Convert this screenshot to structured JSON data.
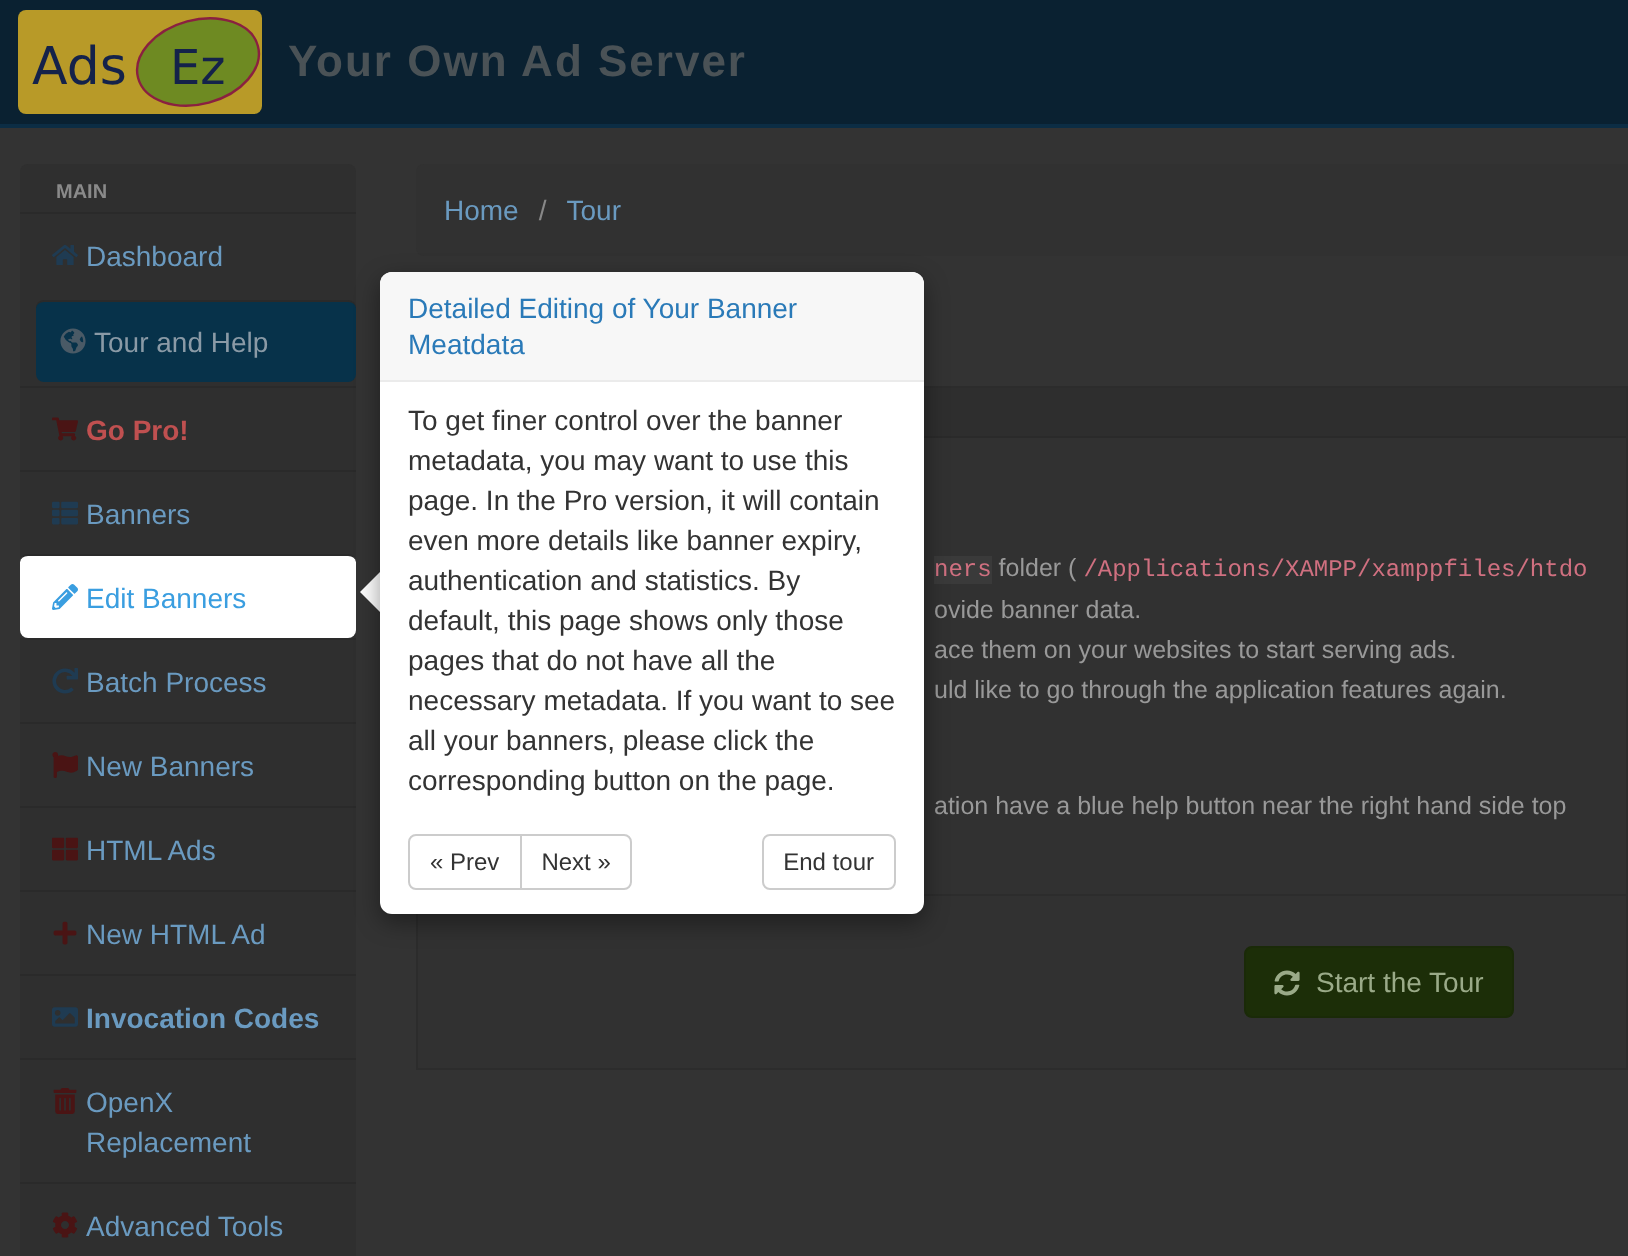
{
  "header": {
    "logo": {
      "left": "Ads",
      "right": "Ez"
    },
    "title": "Your Own Ad Server"
  },
  "sidebar": {
    "heading": "MAIN",
    "items": [
      {
        "label": "Dashboard",
        "color": "#1f3b52",
        "kind": "link",
        "selected": false,
        "highlighted": false
      },
      {
        "label": "Tour and Help",
        "color": "#4a5a66",
        "kind": "link",
        "selected": true,
        "highlighted": false
      },
      {
        "label": "Go Pro!",
        "color": "#4a1414",
        "kind": "promo",
        "selected": false,
        "highlighted": false
      },
      {
        "label": "Banners",
        "color": "#1f3b52",
        "kind": "link",
        "selected": false,
        "highlighted": false
      },
      {
        "label": "Edit Banners",
        "color": "#3a9ee0",
        "kind": "link",
        "selected": false,
        "highlighted": true
      },
      {
        "label": "Batch Process",
        "color": "#1f3b52",
        "kind": "link",
        "selected": false,
        "highlighted": false
      },
      {
        "label": "New Banners",
        "color": "#4a1414",
        "kind": "link",
        "selected": false,
        "highlighted": false
      },
      {
        "label": "HTML Ads",
        "color": "#4a1414",
        "kind": "link",
        "selected": false,
        "highlighted": false
      },
      {
        "label": "New HTML Ad",
        "color": "#4a1414",
        "kind": "link",
        "selected": false,
        "highlighted": false
      },
      {
        "label": "Invocation Codes",
        "color": "#1f3b52",
        "kind": "strong",
        "selected": false,
        "highlighted": false
      },
      {
        "label": "OpenX Replacement",
        "color": "#4a1414",
        "kind": "link",
        "selected": false,
        "highlighted": false
      },
      {
        "label": "Advanced Tools",
        "color": "#4a1414",
        "kind": "link",
        "selected": false,
        "highlighted": false
      }
    ]
  },
  "breadcrumb": {
    "items": [
      "Home",
      "Tour"
    ],
    "separator": "/"
  },
  "content": {
    "first_line": {
      "code": "ners",
      "text": "folder (",
      "path": "/Applications/XAMPP/xamppfiles/htdo"
    },
    "lines": [
      "ovide banner data.",
      "ace them on your websites to start serving ads.",
      "uld like to go through the application features again."
    ],
    "help_line": "ation have a blue help button near the right hand side top",
    "button": "Start the Tour"
  },
  "popover": {
    "title": "Detailed Editing of Your Banner Meatdata",
    "body": "To get finer control over the banner metadata, you may want to use this page. In the Pro version, it will contain even more details like banner expiry, authentication and statistics. By default, this page shows only those pages that do not have all the necessary metadata. If you want to see all your banners, please click the corresponding button on the page.",
    "prev": "« Prev",
    "next": "Next »",
    "end": "End tour"
  }
}
